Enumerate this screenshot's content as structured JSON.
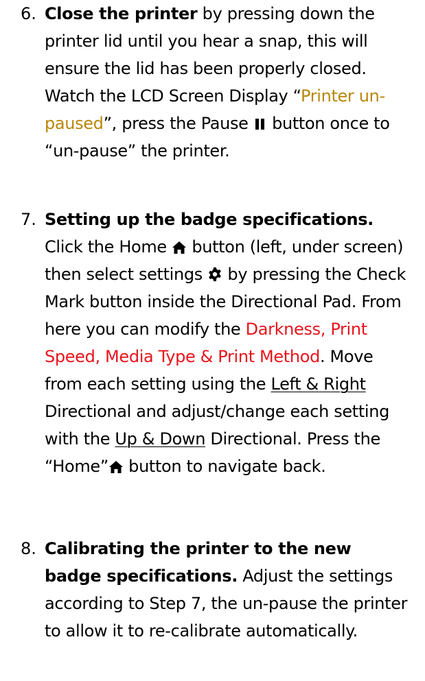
{
  "steps": [
    {
      "number": "6.",
      "title": "Close the printer",
      "t1": " by pressing down the printer lid until you hear a snap, this will ensure the lid has been properly closed. Watch the LCD Screen Display “",
      "lcd_message": "Printer un-paused",
      "t2": "”, press the Pause ",
      "t3": " button once to “un-pause” the printer.",
      "icons": [
        "pause-icon"
      ]
    },
    {
      "number": "7.",
      "title": "Setting up the badge specifications.",
      "t1": " Click the Home ",
      "t2": " button (left, under screen) then select settings ",
      "t3": " by pressing the Check Mark button inside the Directional Pad. From here you can modify the ",
      "settings_list": "Darkness, Print Speed, Media Type & Print Method",
      "t4": ". Move from each setting using the ",
      "left_right": "Left & Right",
      "t5": " Directional and adjust/change each setting with the ",
      "up_down": "Up & Down",
      "t6": " Directional. Press the “Home”",
      "t7": " button to navigate back.",
      "icons": [
        "home-icon",
        "gear-icon",
        "home-icon"
      ]
    },
    {
      "number": "8.",
      "title": "Calibrating the printer to the new badge specifications.",
      "t1": " Adjust the settings according to Step 7, the un-pause the printer to allow it to re-calibrate automatically."
    }
  ],
  "colors": {
    "lcd_message": "#b8860b",
    "settings_list": "#e8141c",
    "text": "#000000"
  }
}
